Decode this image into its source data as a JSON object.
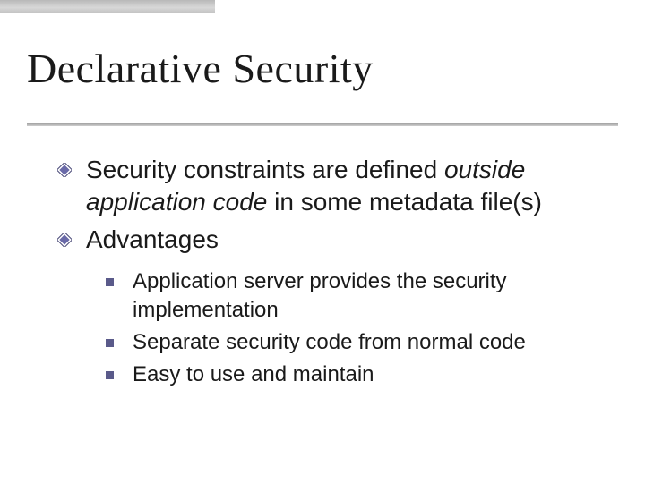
{
  "title": "Declarative Security",
  "bullets": {
    "b1": {
      "pre": "Security constraints are defined ",
      "em1": "outside application code",
      "post": " in some metadata file(s)"
    },
    "b2": {
      "label": "Advantages",
      "subs": {
        "s1": "Application server provides the security implementation",
        "s2": "Separate security code from normal code",
        "s3": "Easy to use and maintain"
      }
    }
  }
}
